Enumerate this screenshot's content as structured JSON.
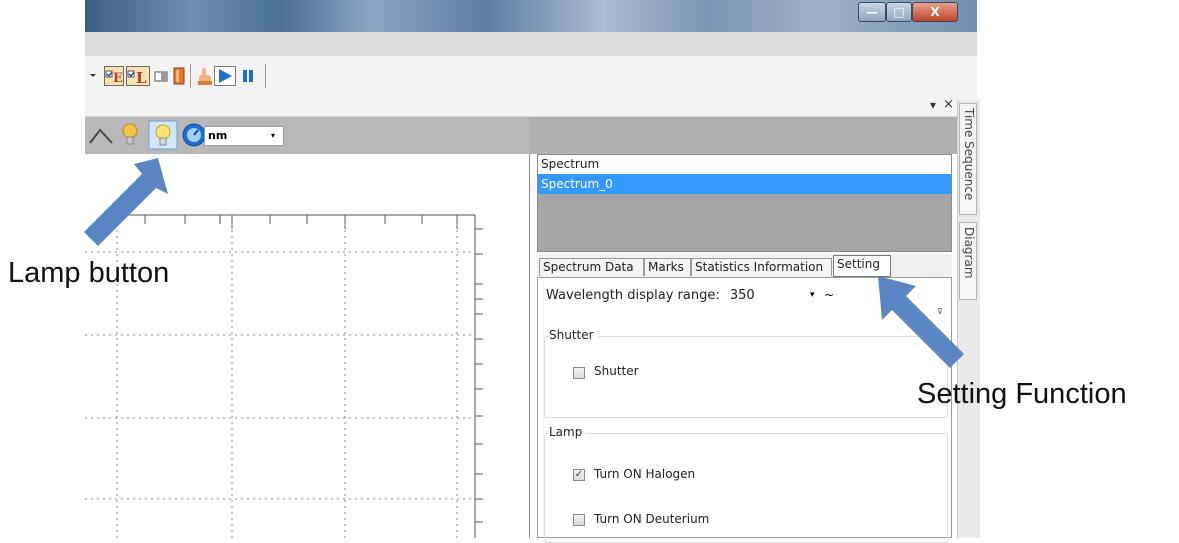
{
  "window": {
    "controls": {
      "minimize": "—",
      "maximize": "□",
      "close": "X"
    }
  },
  "docpane": {
    "pin_label": "▾",
    "close_label": "×"
  },
  "chart_toolbar": {
    "unit_select": {
      "value": "nm",
      "arrow": "▾"
    }
  },
  "spectrum_list": {
    "header": "Spectrum",
    "rows": [
      "Spectrum_0"
    ]
  },
  "tabs": [
    {
      "label": "Spectrum Data"
    },
    {
      "label": "Marks"
    },
    {
      "label": "Statistics Information"
    },
    {
      "label": "Setting",
      "active": true
    }
  ],
  "setting": {
    "range_label": "Wavelength display range:",
    "range_value": "350",
    "range_arrow": "▾",
    "range_sep": "~",
    "scroll_glyph": "⊽",
    "shutter": {
      "group_title": "Shutter",
      "options": [
        {
          "label": "Shutter",
          "checked": false
        }
      ]
    },
    "lamp": {
      "group_title": "Lamp",
      "options": [
        {
          "label": "Turn ON Halogen",
          "checked": true
        },
        {
          "label": "Turn ON Deuterium",
          "checked": false
        }
      ]
    }
  },
  "right_rail": {
    "tabs": [
      {
        "label": "Time Sequence"
      },
      {
        "label": "Diagram"
      }
    ]
  },
  "annotations": {
    "lamp_button": "Lamp button",
    "setting_function": "Setting Function",
    "arrow_color": "#5b86c3"
  },
  "colors": {
    "selection": "#3399ff",
    "accent_blue": "#2f5f9e"
  }
}
